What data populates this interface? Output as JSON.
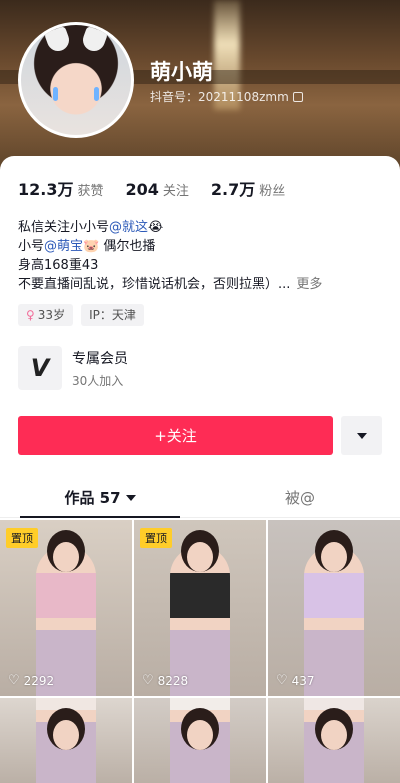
{
  "profile": {
    "nickname": "萌小萌",
    "douyin_id": "抖音号：20211108zmm"
  },
  "stats": [
    {
      "num": "12.3万",
      "label": "获赞"
    },
    {
      "num": "204",
      "label": "关注"
    },
    {
      "num": "2.7万",
      "label": "粉丝"
    }
  ],
  "bio": {
    "line1_prefix": "私信关注小小号",
    "line1_mention": "@就这",
    "line1_emoji": "😭",
    "line2_prefix": "小号",
    "line2_mention": "@萌宝",
    "line2_emoji": "🐷",
    "line2_suffix": " 偶尔也播",
    "line3": "身高168重43",
    "line4": "不要直播间乱说，珍惜说话机会，否则拉黑）...",
    "more": "更多"
  },
  "tags": {
    "age_icon": "♀",
    "age": "33岁",
    "ip": "IP：天津"
  },
  "member": {
    "logo": "V",
    "title": "专属会员",
    "subtitle": "30人加入"
  },
  "actions": {
    "follow": "+关注"
  },
  "tabs": {
    "works": "作品 57",
    "liked": "被@"
  },
  "posts": [
    {
      "pinned": "置顶",
      "likes": "2292",
      "top": "#d9cfc4",
      "outfit": "#e8b8c8"
    },
    {
      "pinned": "置顶",
      "likes": "8228",
      "top": "#cfc6bc",
      "outfit": "#2a2a2a"
    },
    {
      "pinned": "",
      "likes": "437",
      "top": "#c8c2be",
      "outfit": "#d8c2e6"
    },
    {
      "pinned": "",
      "likes": "",
      "top": "#ddd6cf",
      "outfit": "#f0e7e2"
    },
    {
      "pinned": "",
      "likes": "",
      "top": "#d3ccc6",
      "outfit": "#f2ede9"
    },
    {
      "pinned": "",
      "likes": "",
      "top": "#dad3cc",
      "outfit": "#efe7e4"
    }
  ]
}
